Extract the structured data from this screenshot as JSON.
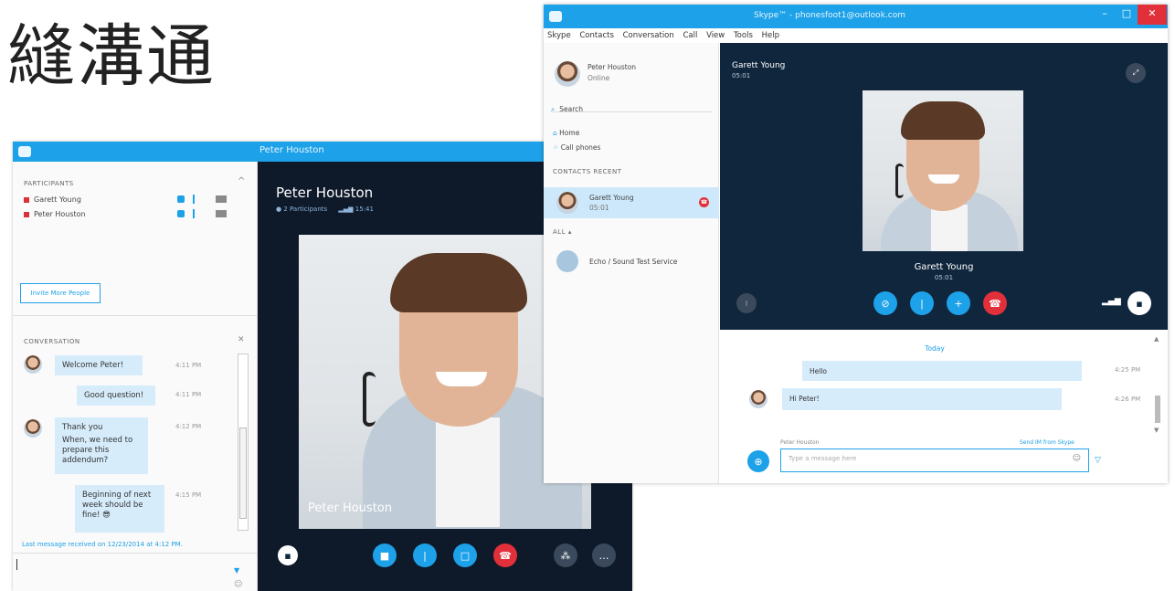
{
  "page_title": "縫溝通",
  "left_window": {
    "title": "Peter Houston",
    "participants": {
      "header": "PARTICIPANTS",
      "people": [
        "Garett Young",
        "Peter Houston"
      ]
    },
    "invite_button": "Invite More People",
    "conversation": {
      "header": "CONVERSATION",
      "messages": [
        {
          "text": "Welcome Peter!",
          "time": "4:11 PM",
          "avatar": true
        },
        {
          "text": "Good question!",
          "time": "4:11 PM",
          "avatar": false
        },
        {
          "text": "Thank you",
          "text2": "When, we need to prepare this addendum?",
          "time": "4:12 PM",
          "avatar": true
        },
        {
          "text": "Beginning of next week should be fine!",
          "emoji": "😎",
          "time": "4:15 PM",
          "avatar": false
        }
      ]
    },
    "last_message": "Last message received on 12/23/2014 at 4:12 PM.",
    "video": {
      "name": "Peter Houston",
      "status": "2 Participants",
      "quality": "15:41",
      "caption": "Peter Houston"
    }
  },
  "right_window": {
    "title": "Skype™ - phonesfoot1@outlook.com",
    "menu": [
      "Skype",
      "Contacts",
      "Conversation",
      "Call",
      "View",
      "Tools",
      "Help"
    ],
    "profile": {
      "name": "Peter Houston",
      "status": "Online"
    },
    "search": "Search",
    "nav": [
      "Home",
      "Call phones"
    ],
    "contacts_header": "CONTACTS    RECENT",
    "contacts": [
      {
        "name": "Garett Young",
        "sub": "05:01"
      },
      {
        "name": "Echo / Sound Test Service",
        "sub": ""
      }
    ],
    "all_header": "ALL ▴",
    "call": {
      "name": "Garett Young",
      "time_top": "05:01",
      "caption": "Garett Young",
      "caption_time": "05:01"
    },
    "chat": {
      "day": "Today",
      "messages": [
        {
          "text": "Hello",
          "time": "4:25 PM"
        },
        {
          "text": "Hi Peter!",
          "time": "4:26 PM"
        }
      ],
      "sender_hint": "Peter Houston",
      "via_link": "Send IM from Skype",
      "input_placeholder": "Type a message here"
    }
  },
  "colors": {
    "accent": "#1da1e8",
    "end_call": "#e2303a",
    "video_bg": "#10263d",
    "bubble": "#d6ecfb"
  }
}
